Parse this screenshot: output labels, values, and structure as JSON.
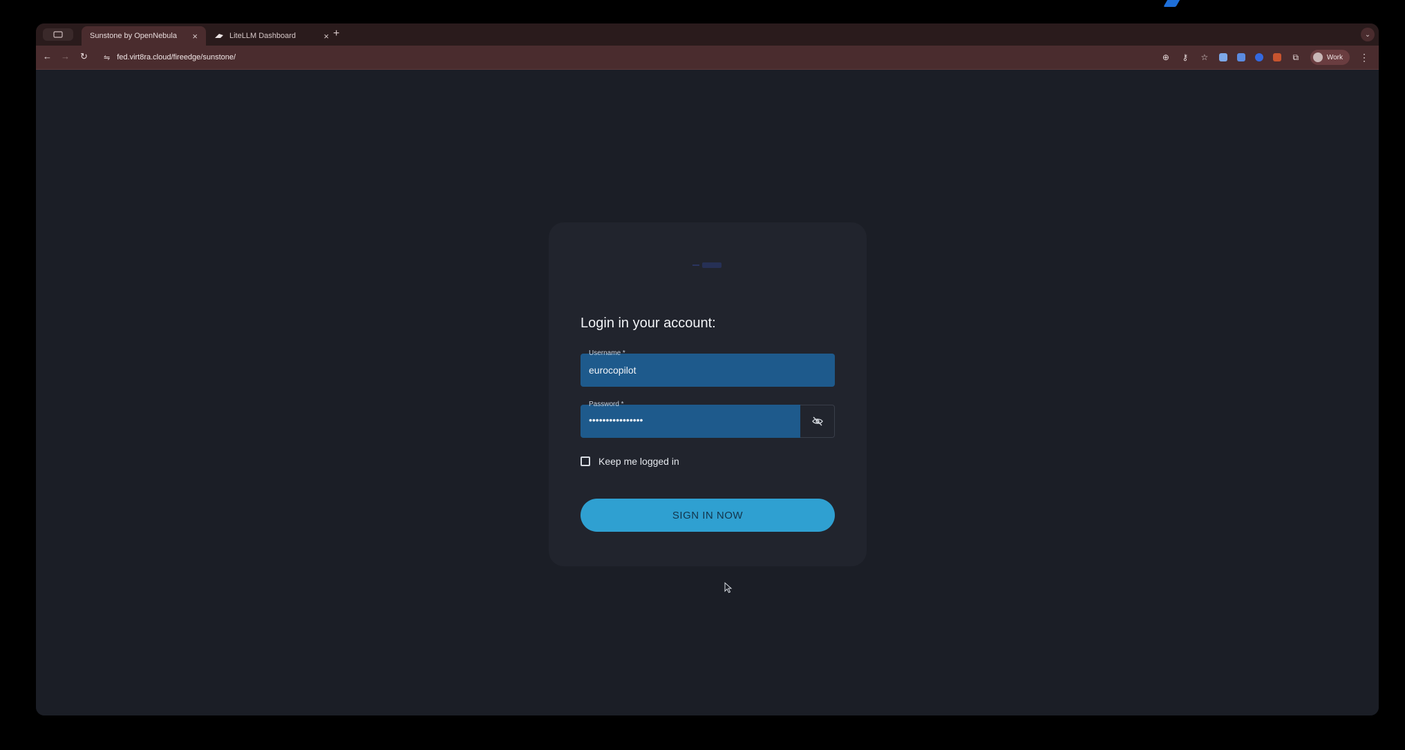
{
  "browser": {
    "tabs": [
      {
        "label": "Sunstone by OpenNebula",
        "active": true
      },
      {
        "label": "LiteLLM Dashboard",
        "active": false
      }
    ],
    "url": "fed.virt8ra.cloud/fireedge/sunstone/",
    "profile_label": "Work",
    "icons": {
      "back": "arrow-left-icon",
      "forward": "arrow-right-icon",
      "reload": "reload-icon",
      "site_info": "tune-icon",
      "zoom": "zoom-icon",
      "password": "key-icon",
      "bookmark": "star-icon",
      "extensions": "puzzle-icon",
      "menu": "kebab-icon"
    }
  },
  "login": {
    "title": "Login in your account:",
    "username_label": "Username *",
    "username_value": "eurocopilot",
    "password_label": "Password *",
    "password_value": "••••••••••••••••",
    "keep_logged_in": "Keep me logged in",
    "keep_logged_in_checked": false,
    "sign_in": "SIGN IN NOW"
  },
  "colors": {
    "accent": "#2fa0d1",
    "field_bg": "#1e5a8c",
    "page_bg": "#1b1e26",
    "card_bg": "#21242d",
    "browser_frame": "#4a2c2e"
  }
}
